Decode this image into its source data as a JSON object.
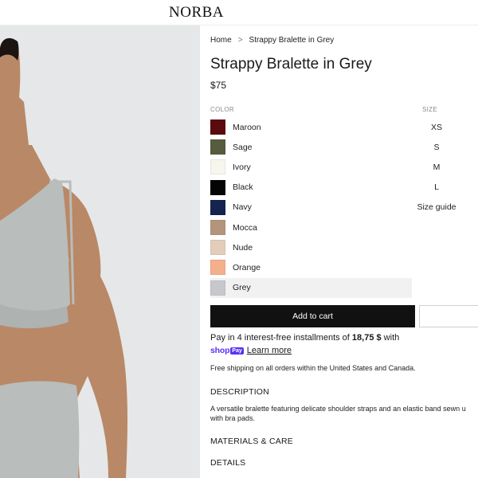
{
  "header": {
    "logo": "NORBA"
  },
  "breadcrumb": {
    "home": "Home",
    "separator": ">",
    "current": "Strappy Bralette in Grey"
  },
  "product": {
    "title": "Strappy Bralette in Grey",
    "price": "$75"
  },
  "color_label": "COLOR",
  "size_label": "SIZE",
  "colors": [
    {
      "name": "Maroon",
      "hex": "#5b0a0d"
    },
    {
      "name": "Sage",
      "hex": "#565c3e"
    },
    {
      "name": "Ivory",
      "hex": "#f6f5ee"
    },
    {
      "name": "Black",
      "hex": "#050505"
    },
    {
      "name": "Navy",
      "hex": "#14244f"
    },
    {
      "name": "Mocca",
      "hex": "#b3957c"
    },
    {
      "name": "Nude",
      "hex": "#e2cdbb"
    },
    {
      "name": "Orange",
      "hex": "#f4b08a"
    },
    {
      "name": "Grey",
      "hex": "#c7c8cc"
    }
  ],
  "selected_color": "Grey",
  "sizes": [
    "XS",
    "S",
    "M",
    "L"
  ],
  "size_guide": "Size guide",
  "add_to_cart": "Add to cart",
  "installments": {
    "prefix": "Pay in 4 interest-free installments of ",
    "amount": "18,75 $",
    "suffix": " with"
  },
  "shop_pay": {
    "shop": "shop",
    "pay": "Pay",
    "learn_more": "Learn more"
  },
  "shipping": "Free shipping on all orders within the United States and Canada.",
  "description": {
    "heading": "DESCRIPTION",
    "line1": "A versatile bralette featuring delicate shoulder straps and an elastic band sewn u",
    "line2": "with bra pads."
  },
  "materials_heading": "MATERIALS & CARE",
  "details_heading": "DETAILS",
  "image_colors": {
    "background": "#e6e7e8",
    "skin": "#b98866",
    "garment": "#b9bdbb"
  }
}
